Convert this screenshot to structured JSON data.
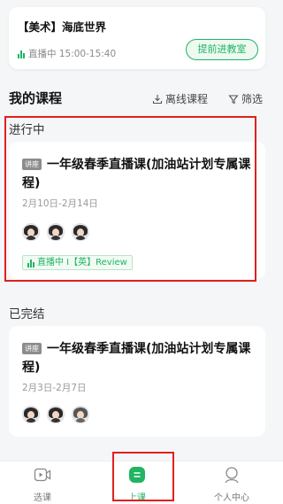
{
  "live_banner": {
    "title": "【美术】海底世界",
    "status": "直播中 15:00-15:40",
    "enter_button": "提前进教室"
  },
  "my_courses": {
    "title": "我的课程",
    "offline_label": "离线课程",
    "filter_label": "筛选"
  },
  "in_progress": {
    "label": "进行中",
    "course": {
      "tag": "讲座",
      "title": "一年级春季直播课(加油站计划专属课程)",
      "date": "2月10日-2月14日",
      "live_tag": "直播中 I【英】Review"
    }
  },
  "completed": {
    "label": "已完结",
    "course": {
      "tag": "讲座",
      "title": "一年级春季直播课(加油站计划专属课程)",
      "date": "2月3日-2月7日"
    }
  },
  "tabbar": {
    "tabs": [
      {
        "label": "选课",
        "icon": "video-icon"
      },
      {
        "label": "上课",
        "icon": "class-icon"
      },
      {
        "label": "个人中心",
        "icon": "person-icon"
      }
    ]
  },
  "colors": {
    "accent": "#20b463",
    "highlight_frame": "#e02020"
  }
}
